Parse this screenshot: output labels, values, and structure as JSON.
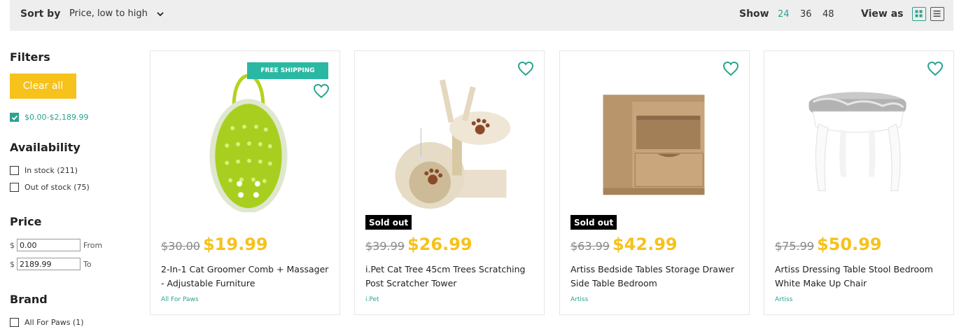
{
  "toolbar": {
    "sort_label": "Sort by",
    "sort_value": "Price, low to high",
    "show_label": "Show",
    "show_options": [
      "24",
      "36",
      "48"
    ],
    "show_active": "24",
    "view_label": "View as",
    "accent_color": "#2aa38f"
  },
  "sidebar": {
    "filters_heading": "Filters",
    "clear_all": "Clear all",
    "active_filter": "$0.00-$2,189.99",
    "availability_heading": "Availability",
    "availability": [
      {
        "label": "In stock (211)",
        "checked": false
      },
      {
        "label": "Out of stock (75)",
        "checked": false
      }
    ],
    "price_heading": "Price",
    "price_currency": "$",
    "price_from_value": "0.00",
    "price_from_label": "From",
    "price_to_value": "2189.99",
    "price_to_label": "To",
    "brand_heading": "Brand",
    "brands": [
      {
        "label": "All For Paws (1)",
        "checked": false
      }
    ]
  },
  "products": [
    {
      "badge": "FREE SHIPPING",
      "sold_out": "",
      "old_price": "$30.00",
      "price": "$19.99",
      "title": "2-In-1 Cat Groomer Comb + Massager - Adjustable Furniture",
      "brand": "All For Paws",
      "image_icon": "cat-groomer-comb-image"
    },
    {
      "badge": "",
      "sold_out": "Sold out",
      "old_price": "$39.99",
      "price": "$26.99",
      "title": "i.Pet Cat Tree 45cm Trees Scratching Post Scratcher Tower",
      "brand": "i.Pet",
      "image_icon": "cat-tree-image"
    },
    {
      "badge": "",
      "sold_out": "Sold out",
      "old_price": "$63.99",
      "price": "$42.99",
      "title": "Artiss Bedside Tables Storage Drawer Side Table Bedroom",
      "brand": "Artiss",
      "image_icon": "bedside-table-image"
    },
    {
      "badge": "",
      "sold_out": "",
      "old_price": "$75.99",
      "price": "$50.99",
      "title": "Artiss Dressing Table Stool Bedroom White Make Up Chair",
      "brand": "Artiss",
      "image_icon": "dressing-stool-image"
    }
  ],
  "colors": {
    "price": "#f6c21b",
    "teal": "#2aa38f",
    "badge": "#2bb8a2"
  }
}
